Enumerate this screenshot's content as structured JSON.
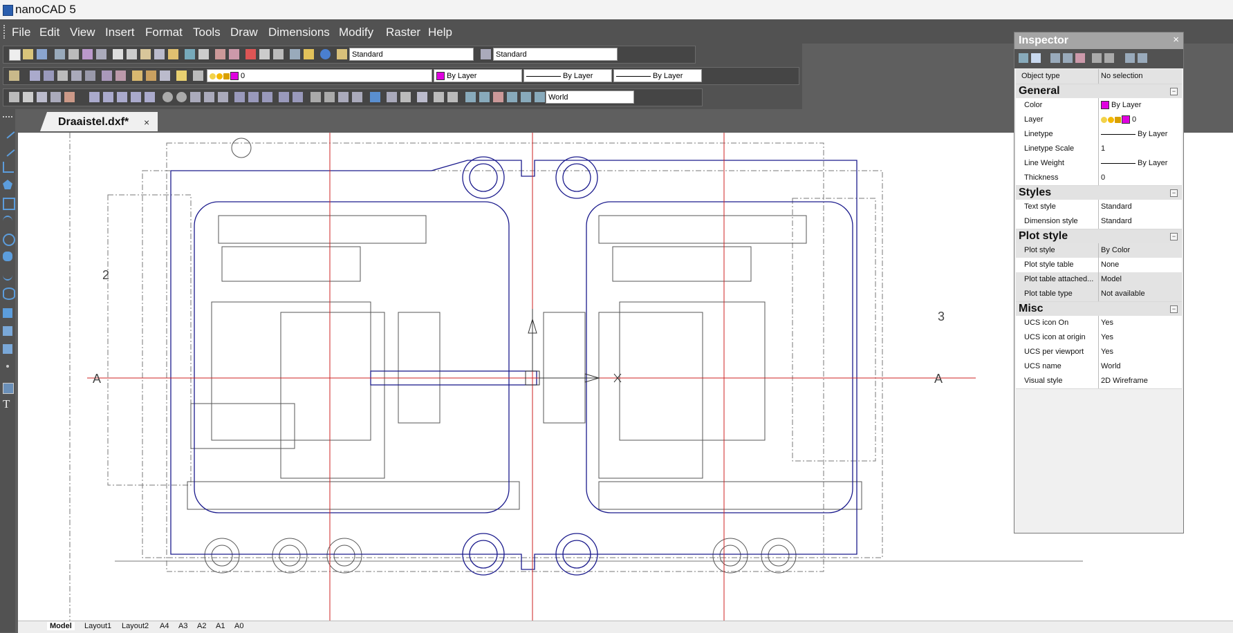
{
  "window": {
    "title": "nanoCAD 5"
  },
  "menu": [
    "File",
    "Edit",
    "View",
    "Insert",
    "Format",
    "Tools",
    "Draw",
    "Dimensions",
    "Modify",
    "Raster",
    "Help"
  ],
  "toolbar": {
    "text_style": "Standard",
    "dim_style": "Standard",
    "layer": "0",
    "color": "By Layer",
    "linetype": "By Layer",
    "lineweight": "By Layer",
    "ucs": "World"
  },
  "document": {
    "tab_label": "Draaistel.dxf*",
    "close_glyph": "×"
  },
  "drawing": {
    "labels": {
      "a_left": "A",
      "a_right": "A",
      "two": "2",
      "three": "3"
    }
  },
  "layouts": [
    "Model",
    "Layout1",
    "Layout2",
    "A4",
    "A3",
    "A2",
    "A1",
    "A0"
  ],
  "inspector": {
    "title": "Inspector",
    "close_glyph": "×",
    "object_type": {
      "key": "Object type",
      "value": "No selection"
    },
    "categories": [
      {
        "name": "General",
        "props": [
          {
            "key": "Color",
            "value": "By Layer"
          },
          {
            "key": "Layer",
            "value": "0"
          },
          {
            "key": "Linetype",
            "value": "By Layer"
          },
          {
            "key": "Linetype Scale",
            "value": "1"
          },
          {
            "key": "Line Weight",
            "value": "By Layer"
          },
          {
            "key": "Thickness",
            "value": "0"
          }
        ]
      },
      {
        "name": "Styles",
        "props": [
          {
            "key": "Text style",
            "value": "Standard"
          },
          {
            "key": "Dimension style",
            "value": "Standard"
          }
        ]
      },
      {
        "name": "Plot style",
        "props": [
          {
            "key": "Plot style",
            "value": "By Color"
          },
          {
            "key": "Plot style table",
            "value": "None"
          },
          {
            "key": "Plot table attached...",
            "value": "Model"
          },
          {
            "key": "Plot table type",
            "value": "Not available"
          }
        ]
      },
      {
        "name": "Misc",
        "props": [
          {
            "key": "UCS icon On",
            "value": "Yes"
          },
          {
            "key": "UCS icon at origin",
            "value": "Yes"
          },
          {
            "key": "UCS per viewport",
            "value": "Yes"
          },
          {
            "key": "UCS name",
            "value": "World"
          },
          {
            "key": "Visual style",
            "value": "2D Wireframe"
          }
        ]
      }
    ]
  },
  "colors": {
    "layer_color": "#e000e0",
    "frame_blue": "#1a1a8c",
    "axis_red": "#cc2222",
    "background": "#5f5f5f"
  }
}
